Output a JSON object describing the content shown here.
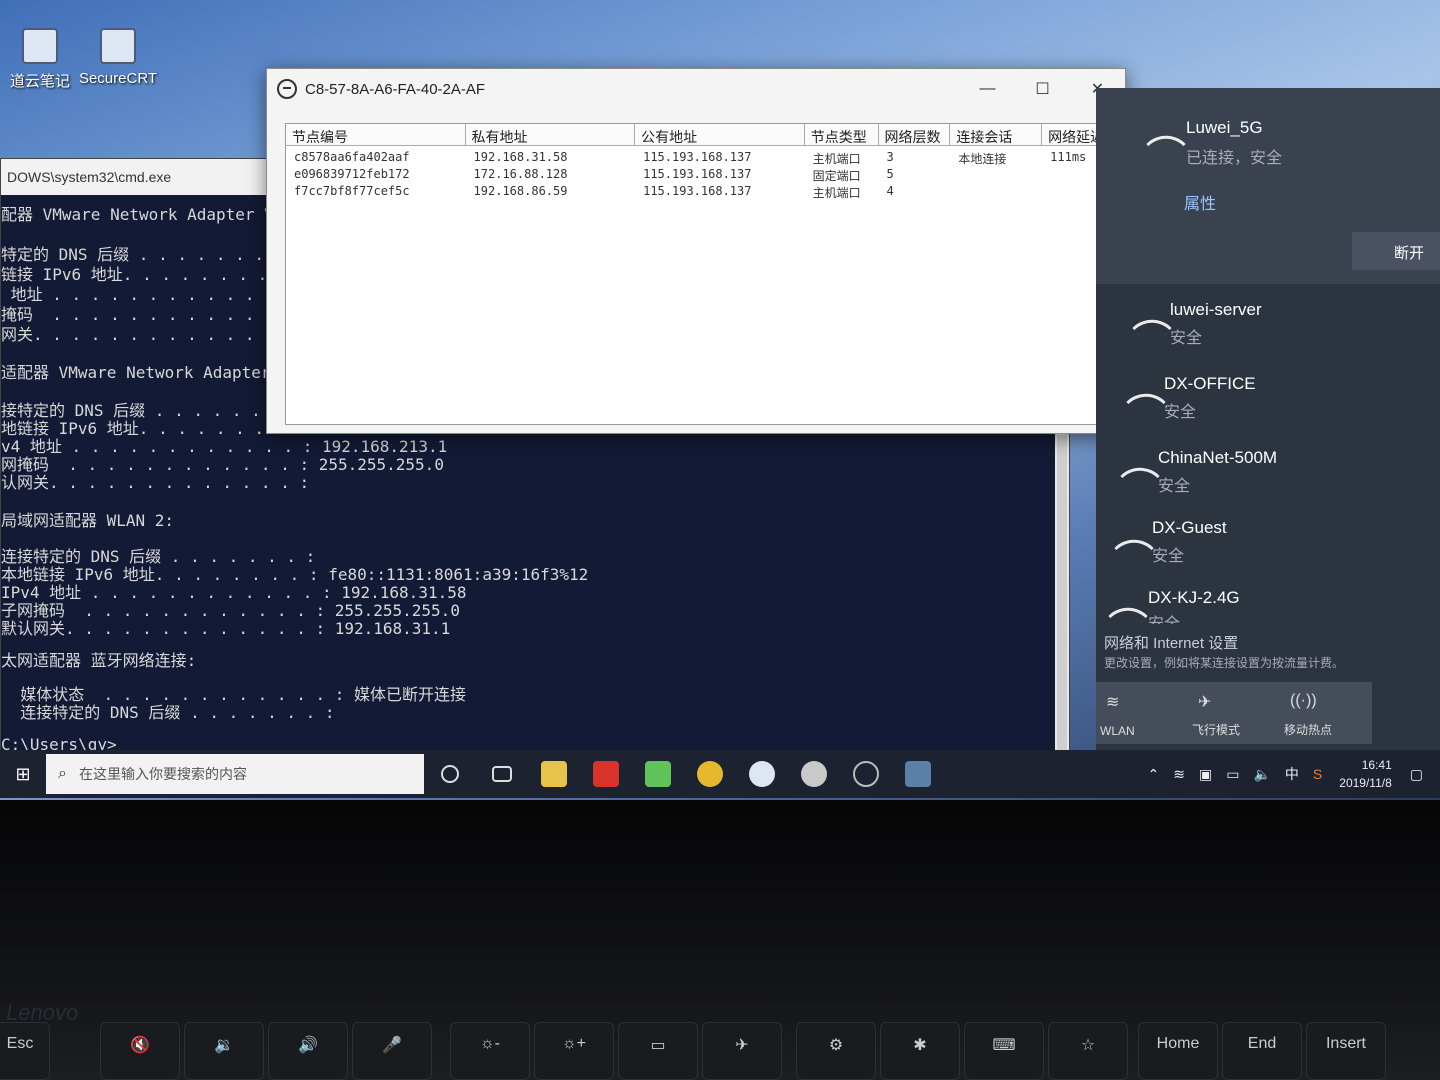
{
  "desktop": {
    "icons": [
      {
        "label": "道云笔记",
        "icon": "note-icon"
      },
      {
        "label": "SecureCRT",
        "icon": "terminal-app-icon"
      }
    ]
  },
  "cmd": {
    "title": "DOWS\\system32\\cmd.exe",
    "lines": [
      "配器 VMware Network Adapter V",
      "特定的 DNS 后缀 . . . . . . .",
      "链接 IPv6 地址. . . . . . . .",
      " 地址 . . . . . . . . . . . .",
      "掩码  . . . . . . . . . . . .",
      "网关. . . . . . . . . . . . .",
      "适配器 VMware Network Adapter V",
      "接特定的 DNS 后缀 . . . . . . . :",
      "地链接 IPv6 地址. . . . . . . . :",
      "v4 地址 . . . . . . . . . . . . : 192.168.213.1",
      "网掩码  . . . . . . . . . . . . : 255.255.255.0",
      "认网关. . . . . . . . . . . . . :",
      "局域网适配器 WLAN 2:",
      "连接特定的 DNS 后缀 . . . . . . . :",
      "本地链接 IPv6 地址. . . . . . . . : fe80::1131:8061:a39:16f3%12",
      "IPv4 地址 . . . . . . . . . . . . : 192.168.31.58",
      "子网掩码  . . . . . . . . . . . . : 255.255.255.0",
      "默认网关. . . . . . . . . . . . . : 192.168.31.1",
      "太网适配器 蓝牙网络连接:",
      "  媒体状态  . . . . . . . . . . . . : 媒体已断开连接",
      "  连接特定的 DNS 后缀 . . . . . . . :",
      "C:\\Users\\gy>"
    ]
  },
  "dialog": {
    "title": "C8-57-8A-A6-FA-40-2A-AF",
    "minimize": "—",
    "maximize": "☐",
    "close": "✕",
    "columns": [
      "节点编号",
      "私有地址",
      "公有地址",
      "节点类型",
      "网络层数",
      "连接会话",
      "网络延迟"
    ],
    "rows": [
      [
        "c8578aa6fa402aaf",
        "192.168.31.58",
        "115.193.168.137",
        "主机端口",
        "3",
        "本地连接",
        "111ms"
      ],
      [
        "e096839712feb172",
        "172.16.88.128",
        "115.193.168.137",
        "固定端口",
        "5",
        "",
        ""
      ],
      [
        "f7cc7bf8f77cef5c",
        "192.168.86.59",
        "115.193.168.137",
        "主机端口",
        "4",
        "",
        ""
      ]
    ]
  },
  "wifi": {
    "connected": {
      "name": "Luwei_5G",
      "status": "已连接，安全",
      "properties": "属性",
      "disconnect": "断开"
    },
    "networks": [
      {
        "name": "luwei-server",
        "status": "安全"
      },
      {
        "name": "DX-OFFICE",
        "status": "安全"
      },
      {
        "name": "ChinaNet-500M",
        "status": "安全"
      },
      {
        "name": "DX-Guest",
        "status": "安全"
      },
      {
        "name": "DX-KJ-2.4G",
        "status": "安全"
      }
    ],
    "settings_title": "网络和 Internet 设置",
    "settings_desc": "更改设置，例如将某连接设置为按流量计费。",
    "quick": [
      {
        "label": "WLAN",
        "icon": "wifi-icon"
      },
      {
        "label": "飞行模式",
        "icon": "airplane-icon"
      },
      {
        "label": "移动热点",
        "icon": "hotspot-icon"
      }
    ]
  },
  "taskbar": {
    "search_placeholder": "在这里输入你要搜索的内容",
    "apps": [
      "task-view-icon",
      "widgets-icon",
      "file-explorer-icon",
      "red-app-icon",
      "green-app-icon",
      "chrome-icon",
      "cloud-app-icon",
      "disc-app-icon",
      "network-app-icon",
      "screen-app-icon"
    ],
    "tray": {
      "ime": "中",
      "time": "16:41",
      "date": "2019/11/8"
    }
  },
  "keyboard": {
    "brand": "Lenovo",
    "keys": [
      "Esc",
      "🔇",
      "🔉",
      "🔊",
      "🎤",
      "☼-",
      "☼+",
      "▭",
      "✈",
      "⚙",
      "✱",
      "⌨",
      "☆",
      "Home",
      "End",
      "Insert"
    ]
  }
}
